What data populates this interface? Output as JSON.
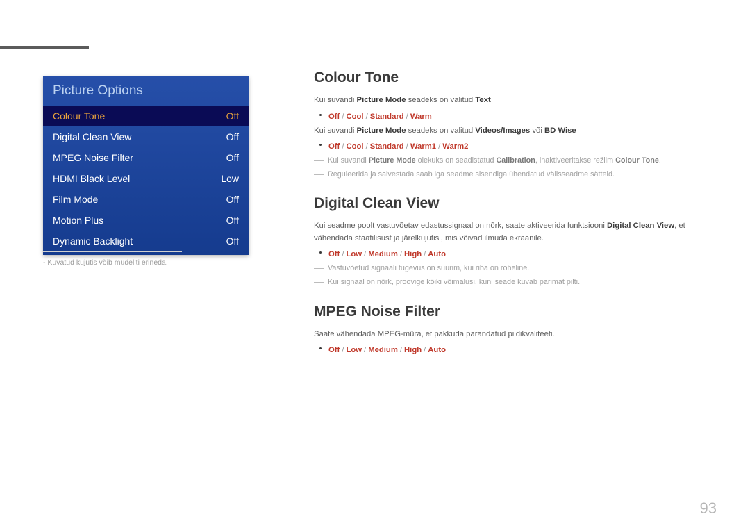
{
  "page_number": "93",
  "menu": {
    "title": "Picture Options",
    "items": [
      {
        "label": "Colour Tone",
        "value": "Off",
        "selected": true
      },
      {
        "label": "Digital Clean View",
        "value": "Off",
        "selected": false
      },
      {
        "label": "MPEG Noise Filter",
        "value": "Off",
        "selected": false
      },
      {
        "label": "HDMI Black Level",
        "value": "Low",
        "selected": false
      },
      {
        "label": "Film Mode",
        "value": "Off",
        "selected": false
      },
      {
        "label": "Motion Plus",
        "value": "Off",
        "selected": false
      },
      {
        "label": "Dynamic Backlight",
        "value": "Off",
        "selected": false
      }
    ]
  },
  "footnote": {
    "dash": "-",
    "text": "Kuvatud kujutis võib mudeliti erineda."
  },
  "sections": {
    "colour_tone": {
      "title": "Colour Tone",
      "line1_pre": "Kui suvandi ",
      "line1_bold1": "Picture Mode",
      "line1_mid": " seadeks on valitud ",
      "line1_bold2": "Text",
      "opts1": [
        "Off",
        "Cool",
        "Standard",
        "Warm"
      ],
      "line2_pre": "Kui suvandi ",
      "line2_bold1": "Picture Mode",
      "line2_mid": " seadeks on valitud ",
      "line2_bold2": "Videos/Images",
      "line2_or": " või ",
      "line2_bold3": "BD Wise",
      "opts2": [
        "Off",
        "Cool",
        "Standard",
        "Warm1",
        "Warm2"
      ],
      "note1_pre": "Kui suvandi ",
      "note1_b1": "Picture Mode",
      "note1_mid": " olekuks on seadistatud ",
      "note1_b2": "Calibration",
      "note1_mid2": ", inaktiveeritakse režiim ",
      "note1_b3": "Colour Tone",
      "note1_end": ".",
      "note2": "Reguleerida ja salvestada saab iga seadme sisendiga ühendatud välisseadme sätteid."
    },
    "dcv": {
      "title": "Digital Clean View",
      "para_pre": "Kui seadme poolt vastuvõetav edastussignaal on nõrk, saate aktiveerida funktsiooni ",
      "para_bold": "Digital Clean View",
      "para_post": ", et vähendada staatilisust ja järelkujutisi, mis võivad ilmuda ekraanile.",
      "opts": [
        "Off",
        "Low",
        "Medium",
        "High",
        "Auto"
      ],
      "note1": "Vastuvõetud signaali tugevus on suurim, kui riba on roheline.",
      "note2": "Kui signaal on nõrk, proovige kõiki võimalusi, kuni seade kuvab parimat pilti."
    },
    "mpeg": {
      "title": "MPEG Noise Filter",
      "para": "Saate vähendada MPEG-müra, et pakkuda parandatud pildikvaliteeti.",
      "opts": [
        "Off",
        "Low",
        "Medium",
        "High",
        "Auto"
      ]
    }
  }
}
